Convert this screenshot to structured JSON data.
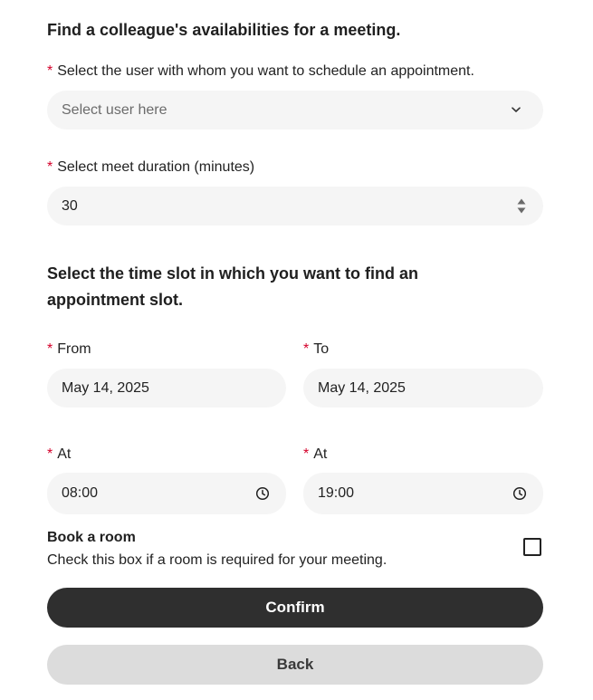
{
  "section1": {
    "title": "Find a colleague's availabilities for a meeting.",
    "user_label": "Select the user with whom you want to schedule an appointment.",
    "user_placeholder": "Select user here",
    "duration_label": "Select meet duration (minutes)",
    "duration_value": "30"
  },
  "section2": {
    "title_line1": "Select the time slot in which you want to find an",
    "title_line2": "appointment slot.",
    "from_label": "From",
    "from_value": "May 14, 2025",
    "to_label": "To",
    "to_value": "May 14, 2025",
    "at_start_label": "At",
    "at_start_value": "08:00",
    "at_end_label": "At",
    "at_end_value": "19:00"
  },
  "room": {
    "title": "Book a room",
    "description": "Check this box if a room is required for your meeting.",
    "checked": false
  },
  "buttons": {
    "confirm": "Confirm",
    "back": "Back"
  },
  "required_marker": "*",
  "icons": {
    "select": "chevron-down-icon",
    "number": "spinner-arrows-icon",
    "time": "clock-icon"
  },
  "colors": {
    "required": "#d4002a",
    "field_bg": "#f5f5f5",
    "primary_button": "#2f2f2f",
    "secondary_button": "#dcdcdc"
  }
}
